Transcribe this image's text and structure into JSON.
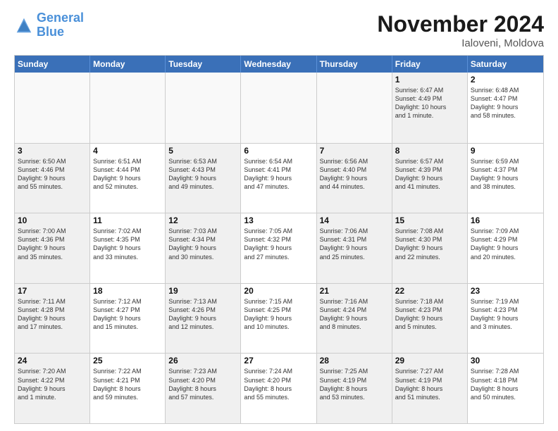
{
  "header": {
    "logo_general": "General",
    "logo_blue": "Blue",
    "month_title": "November 2024",
    "location": "Ialoveni, Moldova"
  },
  "weekdays": [
    "Sunday",
    "Monday",
    "Tuesday",
    "Wednesday",
    "Thursday",
    "Friday",
    "Saturday"
  ],
  "weeks": [
    [
      {
        "day": "",
        "detail": "",
        "empty": true
      },
      {
        "day": "",
        "detail": "",
        "empty": true
      },
      {
        "day": "",
        "detail": "",
        "empty": true
      },
      {
        "day": "",
        "detail": "",
        "empty": true
      },
      {
        "day": "",
        "detail": "",
        "empty": true
      },
      {
        "day": "1",
        "detail": "Sunrise: 6:47 AM\nSunset: 4:49 PM\nDaylight: 10 hours\nand 1 minute.",
        "empty": false,
        "shaded": true
      },
      {
        "day": "2",
        "detail": "Sunrise: 6:48 AM\nSunset: 4:47 PM\nDaylight: 9 hours\nand 58 minutes.",
        "empty": false
      }
    ],
    [
      {
        "day": "3",
        "detail": "Sunrise: 6:50 AM\nSunset: 4:46 PM\nDaylight: 9 hours\nand 55 minutes.",
        "empty": false,
        "shaded": true
      },
      {
        "day": "4",
        "detail": "Sunrise: 6:51 AM\nSunset: 4:44 PM\nDaylight: 9 hours\nand 52 minutes.",
        "empty": false
      },
      {
        "day": "5",
        "detail": "Sunrise: 6:53 AM\nSunset: 4:43 PM\nDaylight: 9 hours\nand 49 minutes.",
        "empty": false,
        "shaded": true
      },
      {
        "day": "6",
        "detail": "Sunrise: 6:54 AM\nSunset: 4:41 PM\nDaylight: 9 hours\nand 47 minutes.",
        "empty": false
      },
      {
        "day": "7",
        "detail": "Sunrise: 6:56 AM\nSunset: 4:40 PM\nDaylight: 9 hours\nand 44 minutes.",
        "empty": false,
        "shaded": true
      },
      {
        "day": "8",
        "detail": "Sunrise: 6:57 AM\nSunset: 4:39 PM\nDaylight: 9 hours\nand 41 minutes.",
        "empty": false,
        "shaded": true
      },
      {
        "day": "9",
        "detail": "Sunrise: 6:59 AM\nSunset: 4:37 PM\nDaylight: 9 hours\nand 38 minutes.",
        "empty": false
      }
    ],
    [
      {
        "day": "10",
        "detail": "Sunrise: 7:00 AM\nSunset: 4:36 PM\nDaylight: 9 hours\nand 35 minutes.",
        "empty": false,
        "shaded": true
      },
      {
        "day": "11",
        "detail": "Sunrise: 7:02 AM\nSunset: 4:35 PM\nDaylight: 9 hours\nand 33 minutes.",
        "empty": false
      },
      {
        "day": "12",
        "detail": "Sunrise: 7:03 AM\nSunset: 4:34 PM\nDaylight: 9 hours\nand 30 minutes.",
        "empty": false,
        "shaded": true
      },
      {
        "day": "13",
        "detail": "Sunrise: 7:05 AM\nSunset: 4:32 PM\nDaylight: 9 hours\nand 27 minutes.",
        "empty": false
      },
      {
        "day": "14",
        "detail": "Sunrise: 7:06 AM\nSunset: 4:31 PM\nDaylight: 9 hours\nand 25 minutes.",
        "empty": false,
        "shaded": true
      },
      {
        "day": "15",
        "detail": "Sunrise: 7:08 AM\nSunset: 4:30 PM\nDaylight: 9 hours\nand 22 minutes.",
        "empty": false,
        "shaded": true
      },
      {
        "day": "16",
        "detail": "Sunrise: 7:09 AM\nSunset: 4:29 PM\nDaylight: 9 hours\nand 20 minutes.",
        "empty": false
      }
    ],
    [
      {
        "day": "17",
        "detail": "Sunrise: 7:11 AM\nSunset: 4:28 PM\nDaylight: 9 hours\nand 17 minutes.",
        "empty": false,
        "shaded": true
      },
      {
        "day": "18",
        "detail": "Sunrise: 7:12 AM\nSunset: 4:27 PM\nDaylight: 9 hours\nand 15 minutes.",
        "empty": false
      },
      {
        "day": "19",
        "detail": "Sunrise: 7:13 AM\nSunset: 4:26 PM\nDaylight: 9 hours\nand 12 minutes.",
        "empty": false,
        "shaded": true
      },
      {
        "day": "20",
        "detail": "Sunrise: 7:15 AM\nSunset: 4:25 PM\nDaylight: 9 hours\nand 10 minutes.",
        "empty": false
      },
      {
        "day": "21",
        "detail": "Sunrise: 7:16 AM\nSunset: 4:24 PM\nDaylight: 9 hours\nand 8 minutes.",
        "empty": false,
        "shaded": true
      },
      {
        "day": "22",
        "detail": "Sunrise: 7:18 AM\nSunset: 4:23 PM\nDaylight: 9 hours\nand 5 minutes.",
        "empty": false,
        "shaded": true
      },
      {
        "day": "23",
        "detail": "Sunrise: 7:19 AM\nSunset: 4:23 PM\nDaylight: 9 hours\nand 3 minutes.",
        "empty": false
      }
    ],
    [
      {
        "day": "24",
        "detail": "Sunrise: 7:20 AM\nSunset: 4:22 PM\nDaylight: 9 hours\nand 1 minute.",
        "empty": false,
        "shaded": true
      },
      {
        "day": "25",
        "detail": "Sunrise: 7:22 AM\nSunset: 4:21 PM\nDaylight: 8 hours\nand 59 minutes.",
        "empty": false
      },
      {
        "day": "26",
        "detail": "Sunrise: 7:23 AM\nSunset: 4:20 PM\nDaylight: 8 hours\nand 57 minutes.",
        "empty": false,
        "shaded": true
      },
      {
        "day": "27",
        "detail": "Sunrise: 7:24 AM\nSunset: 4:20 PM\nDaylight: 8 hours\nand 55 minutes.",
        "empty": false
      },
      {
        "day": "28",
        "detail": "Sunrise: 7:25 AM\nSunset: 4:19 PM\nDaylight: 8 hours\nand 53 minutes.",
        "empty": false,
        "shaded": true
      },
      {
        "day": "29",
        "detail": "Sunrise: 7:27 AM\nSunset: 4:19 PM\nDaylight: 8 hours\nand 51 minutes.",
        "empty": false,
        "shaded": true
      },
      {
        "day": "30",
        "detail": "Sunrise: 7:28 AM\nSunset: 4:18 PM\nDaylight: 8 hours\nand 50 minutes.",
        "empty": false
      }
    ]
  ]
}
